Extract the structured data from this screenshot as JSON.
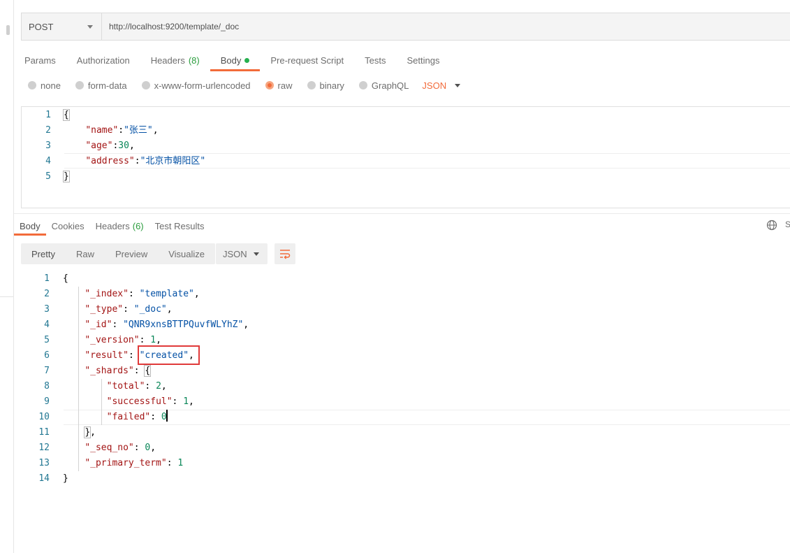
{
  "request": {
    "method": "POST",
    "url": "http://localhost:9200/template/_doc",
    "tabs": [
      {
        "label": "Params"
      },
      {
        "label": "Authorization"
      },
      {
        "label": "Headers",
        "count": "(8)"
      },
      {
        "label": "Body"
      },
      {
        "label": "Pre-request Script"
      },
      {
        "label": "Tests"
      },
      {
        "label": "Settings"
      }
    ],
    "body_types": [
      "none",
      "form-data",
      "x-www-form-urlencoded",
      "raw",
      "binary",
      "GraphQL"
    ],
    "selected_body_type": "raw",
    "raw_format": "JSON",
    "line_numbers": [
      "1",
      "2",
      "3",
      "4",
      "5"
    ],
    "body": {
      "k_name": "\"name\"",
      "v_name": "\"张三\"",
      "k_age": "\"age\"",
      "v_age": "30",
      "k_address": "\"address\"",
      "v_address": "\"北京市朝阳区\""
    }
  },
  "response": {
    "tabs": [
      {
        "label": "Body"
      },
      {
        "label": "Cookies"
      },
      {
        "label": "Headers",
        "count": "(6)"
      },
      {
        "label": "Test Results"
      }
    ],
    "truncated_label": "S",
    "views": [
      "Pretty",
      "Raw",
      "Preview",
      "Visualize"
    ],
    "format": "JSON",
    "line_numbers": [
      "1",
      "2",
      "3",
      "4",
      "5",
      "6",
      "7",
      "8",
      "9",
      "10",
      "11",
      "12",
      "13",
      "14"
    ],
    "json": {
      "k_index": "\"_index\"",
      "v_index": "\"template\"",
      "k_type": "\"_type\"",
      "v_type": "\"_doc\"",
      "k_id": "\"_id\"",
      "v_id": "\"QNR9xnsBTTPQuvfWLYhZ\"",
      "k_version": "\"_version\"",
      "v_version": "1",
      "k_result": "\"result\"",
      "v_result": "\"created\"",
      "k_shards": "\"_shards\"",
      "k_total": "\"total\"",
      "v_total": "2",
      "k_successful": "\"successful\"",
      "v_successful": "1",
      "k_failed": "\"failed\"",
      "v_failed": "0",
      "k_seq_no": "\"_seq_no\"",
      "v_seq_no": "0",
      "k_primary_term": "\"_primary_term\"",
      "v_primary_term": "1"
    }
  },
  "colors": {
    "accent": "#f26b3a",
    "count_green": "#2a9d3d",
    "status_dot": "#26b04f",
    "json_key": "#a31515",
    "json_string": "#0451a5",
    "json_number": "#098658",
    "line_number": "#237893",
    "highlight": "#e03a3a"
  },
  "icons": [
    "chevron-down-icon",
    "globe-icon",
    "wrap-lines-icon"
  ]
}
